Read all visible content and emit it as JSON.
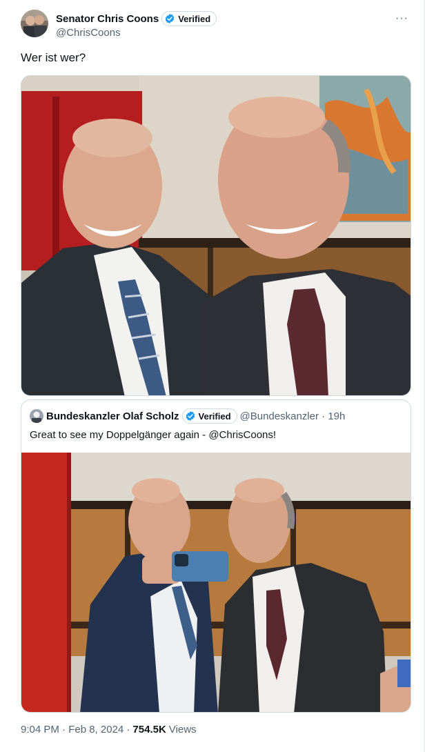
{
  "tweet": {
    "author": {
      "name": "Senator Chris Coons",
      "verified_label": "Verified",
      "handle": "@ChrisCoons"
    },
    "more_label": "···",
    "text": "Wer ist wer?",
    "quote": {
      "author_name": "Bundeskanzler Olaf Scholz",
      "verified_label": "Verified",
      "handle_time": "@Bundeskanzler · 19h",
      "text": "Great to see my Doppelgänger again - @ChrisCoons!"
    },
    "meta": {
      "timestamp": "9:04 PM · Feb 8, 2024 ·",
      "views_count": "754.5K",
      "views_label": "Views"
    }
  },
  "colors": {
    "text_primary": "#0f1419",
    "text_secondary": "#536471",
    "verified_blue": "#1d9bf0",
    "border": "#cfd9de"
  },
  "icons": {
    "verified": "verified-badge-icon",
    "more": "more-dots-icon"
  }
}
